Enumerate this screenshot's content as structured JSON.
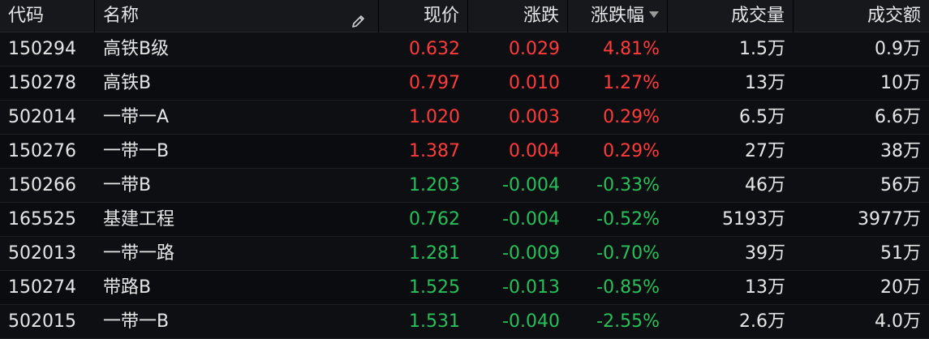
{
  "colors": {
    "up": "#ff3b3b",
    "down": "#27c05a",
    "text": "#e6e6e6",
    "header_bg": "#17181c"
  },
  "header": {
    "code": "代码",
    "name": "名称",
    "price": "现价",
    "change": "涨跌",
    "change_pct": "涨跌幅",
    "volume": "成交量",
    "amount": "成交额",
    "edit_icon": "pencil-icon",
    "sort_icon": "sort-desc-icon"
  },
  "rows": [
    {
      "code": "150294",
      "name": "高铁B级",
      "price": "0.632",
      "change": "0.029",
      "pct": "4.81%",
      "volume": "1.5万",
      "amount": "0.9万",
      "dir": "up"
    },
    {
      "code": "150278",
      "name": "高铁B",
      "price": "0.797",
      "change": "0.010",
      "pct": "1.27%",
      "volume": "13万",
      "amount": "10万",
      "dir": "up"
    },
    {
      "code": "502014",
      "name": "一带一A",
      "price": "1.020",
      "change": "0.003",
      "pct": "0.29%",
      "volume": "6.5万",
      "amount": "6.6万",
      "dir": "up"
    },
    {
      "code": "150276",
      "name": "一带一B",
      "price": "1.387",
      "change": "0.004",
      "pct": "0.29%",
      "volume": "27万",
      "amount": "38万",
      "dir": "up"
    },
    {
      "code": "150266",
      "name": "一带B",
      "price": "1.203",
      "change": "-0.004",
      "pct": "-0.33%",
      "volume": "46万",
      "amount": "56万",
      "dir": "down"
    },
    {
      "code": "165525",
      "name": "基建工程",
      "price": "0.762",
      "change": "-0.004",
      "pct": "-0.52%",
      "volume": "5193万",
      "amount": "3977万",
      "dir": "down"
    },
    {
      "code": "502013",
      "name": "一带一路",
      "price": "1.281",
      "change": "-0.009",
      "pct": "-0.70%",
      "volume": "39万",
      "amount": "51万",
      "dir": "down"
    },
    {
      "code": "150274",
      "name": "带路B",
      "price": "1.525",
      "change": "-0.013",
      "pct": "-0.85%",
      "volume": "13万",
      "amount": "20万",
      "dir": "down"
    },
    {
      "code": "502015",
      "name": "一带一B",
      "price": "1.531",
      "change": "-0.040",
      "pct": "-2.55%",
      "volume": "2.6万",
      "amount": "4.0万",
      "dir": "down"
    }
  ]
}
